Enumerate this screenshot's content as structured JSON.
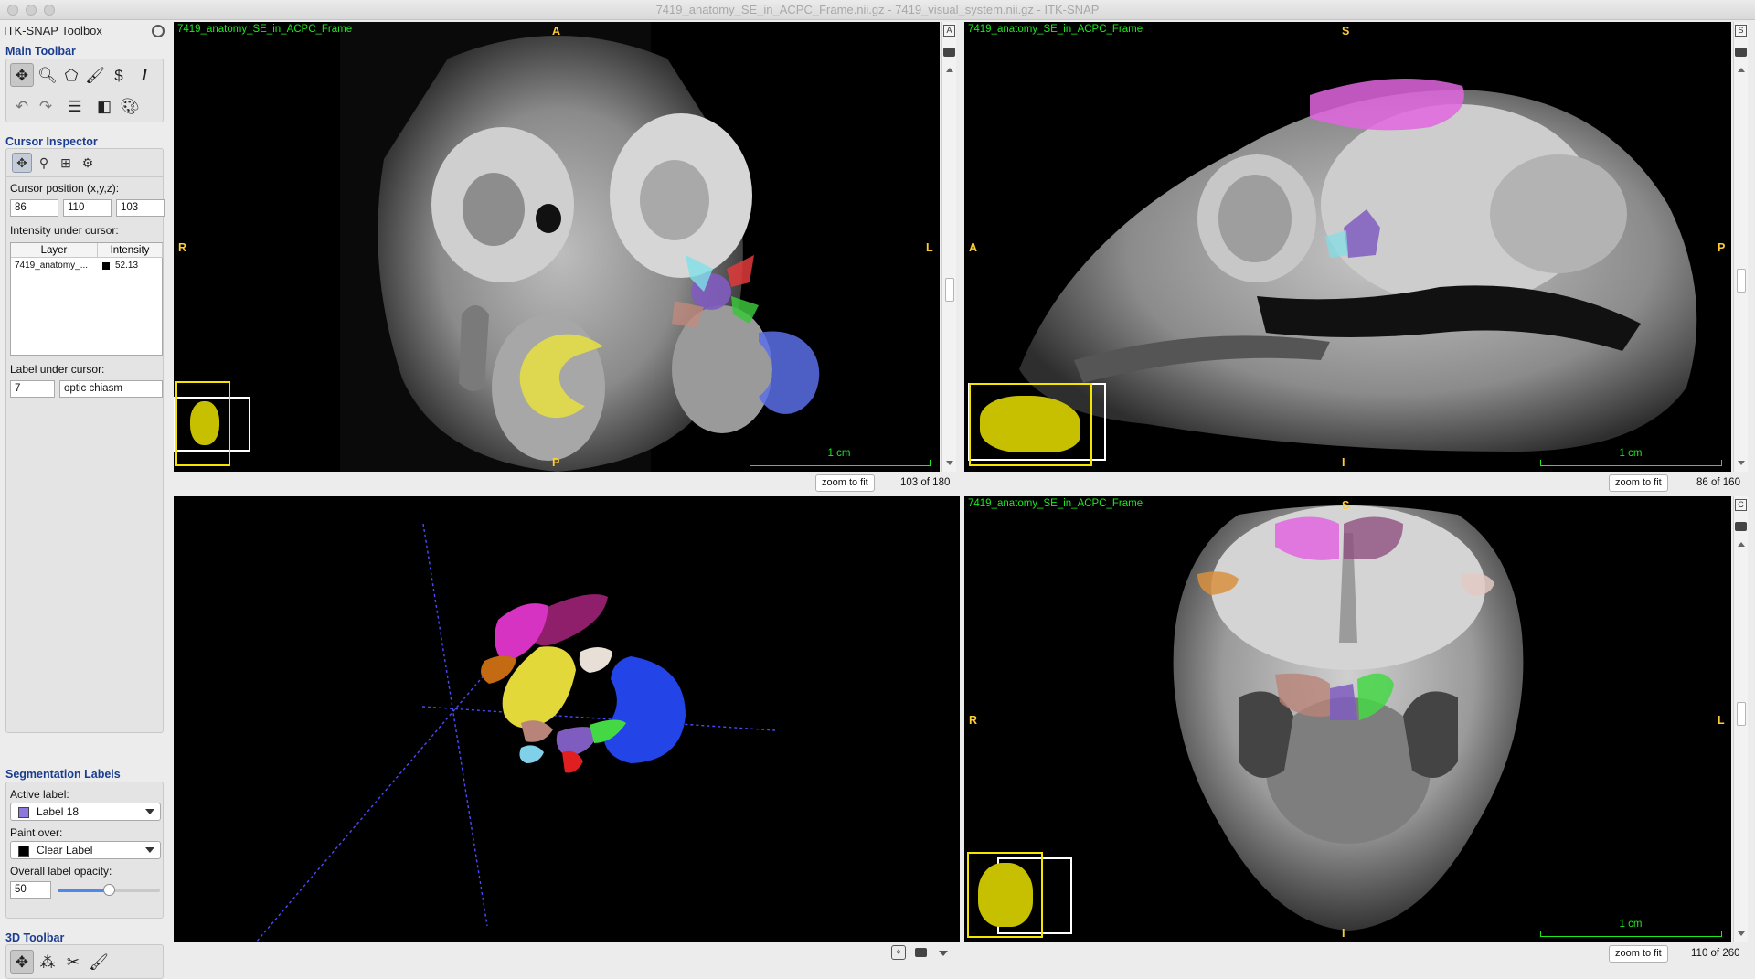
{
  "window": {
    "title": "7419_anatomy_SE_in_ACPC_Frame.nii.gz - 7419_visual_system.nii.gz - ITK-SNAP"
  },
  "toolbox": {
    "title": "ITK-SNAP Toolbox",
    "main_toolbar": {
      "title": "Main Toolbar"
    },
    "cursor_inspector": {
      "title": "Cursor Inspector",
      "position_label": "Cursor position (x,y,z):",
      "x": "86",
      "y": "110",
      "z": "103",
      "intensity_label": "Intensity under cursor:",
      "table_headers": [
        "Layer",
        "Intensity"
      ],
      "rows": [
        {
          "layer": "7419_anatomy_...",
          "intensity": "52.13"
        }
      ],
      "label_under_cursor_label": "Label under cursor:",
      "label_id": "7",
      "label_name": "optic chiasm"
    },
    "segmentation_labels": {
      "title": "Segmentation Labels",
      "active_label_title": "Active label:",
      "active_label": "Label 18",
      "active_label_color": "#8c78dc",
      "paint_over_title": "Paint over:",
      "paint_over": "Clear Label",
      "paint_over_color": "#000000",
      "opacity_title": "Overall label opacity:",
      "opacity_value": "50",
      "opacity_fraction": 0.5
    },
    "toolbar_3d": {
      "title": "3D Toolbar"
    }
  },
  "views": {
    "axial": {
      "title": "7419_anatomy_SE_in_ACPC_Frame",
      "orient_top": "A",
      "orient_bottom": "P",
      "orient_left": "R",
      "orient_right": "L",
      "scale": "1 cm",
      "zoom_btn": "zoom to fit",
      "slice": "103 of 180",
      "side_btn": "A"
    },
    "sagittal": {
      "title": "7419_anatomy_SE_in_ACPC_Frame",
      "orient_top": "S",
      "orient_bottom": "I",
      "orient_left": "A",
      "orient_right": "P",
      "scale": "1 cm",
      "zoom_btn": "zoom to fit",
      "slice": "86 of 160",
      "side_btn": "S"
    },
    "coronal": {
      "title": "7419_anatomy_SE_in_ACPC_Frame",
      "orient_top": "S",
      "orient_bottom": "I",
      "orient_left": "R",
      "orient_right": "L",
      "scale": "1 cm",
      "zoom_btn": "zoom to fit",
      "slice": "110 of 260",
      "side_btn": "C"
    }
  },
  "colors": {
    "overlay_text": "#1ee81e",
    "orient_text": "#ffcc33",
    "section_title": "#1b3d8f",
    "thumb_yellow": "#f5e400"
  }
}
